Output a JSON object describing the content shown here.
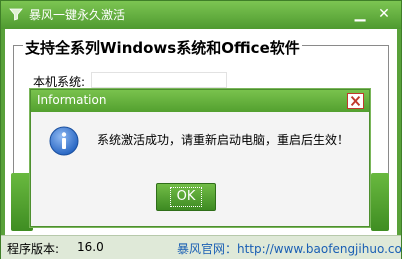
{
  "window": {
    "title": "暴风一键永久激活",
    "minimize_glyph": "▁",
    "close_glyph": "✕"
  },
  "features": {
    "title": "支持全系列Windows系统和Office软件",
    "sysinfo_label": "本机系统:",
    "sysinfo_value": ""
  },
  "statusbar": {
    "version_label": "程序版本:",
    "version_value": "16.0",
    "site_text": "暴风官网：http://www.baofengjihuo.com"
  },
  "dialog": {
    "title": "Information",
    "message": "系统激活成功，请重新启动电脑，重启后生效！",
    "ok_label": "OK",
    "icon": "info-icon"
  },
  "colors": {
    "brand_green": "#59a13a",
    "dialog_close_red": "#c0392b",
    "info_blue": "#1f5fbf"
  }
}
